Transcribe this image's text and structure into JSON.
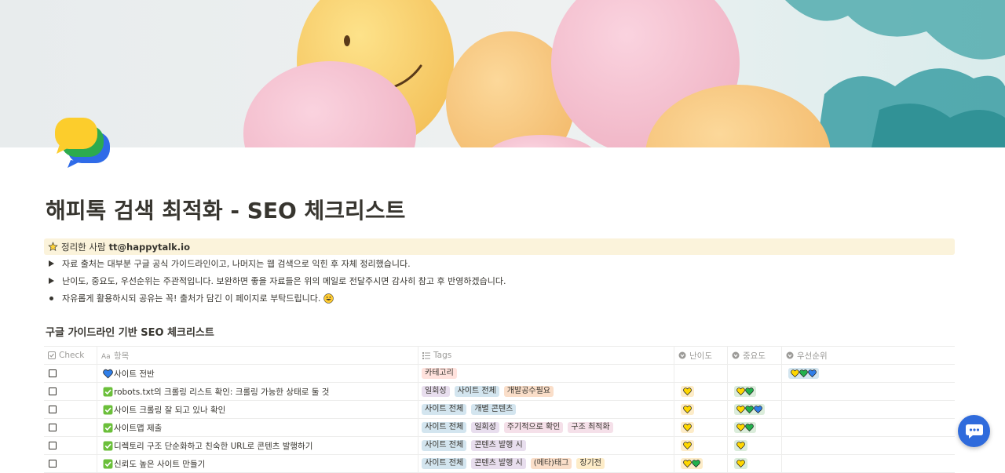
{
  "page": {
    "title": "해피톡 검색 최적화 - SEO 체크리스트",
    "cover_image": "balloons-sky",
    "icon": "chat-bubbles-icon"
  },
  "callout": {
    "icon": "star-icon",
    "label": "정리한 사람",
    "author": "tt@happytalk.io"
  },
  "toggles": [
    "자료 출처는 대부분 구글 공식 가이드라인이고, 나머지는 웹 검색으로 익힌 후 자체 정리했습니다.",
    "난이도, 중요도, 우선순위는 주관적입니다. 보완하면 좋을 자료들은 위의 메일로 전달주시면 감사히 참고 후 반영하겠습니다."
  ],
  "bullet": {
    "text": "자유롭게 활용하시되 공유는 꼭! 출처가 담긴 이 페이지로 부탁드립니다.",
    "emoji": "grinning-face-icon"
  },
  "database": {
    "title": "구글 가이드라인 기반 SEO 체크리스트",
    "columns": [
      "Check",
      "항목",
      "Tags",
      "난이도",
      "중요도",
      "우선순위"
    ],
    "rows": [
      {
        "checked": false,
        "icon": "blue-heart-icon",
        "name": "사이트 전반",
        "tags": [
          {
            "label": "카테고리",
            "color": "red"
          }
        ],
        "difficulty": [],
        "importance": [],
        "priority": [
          "yellow",
          "green",
          "blue"
        ]
      },
      {
        "checked": false,
        "icon": "check-mark-icon",
        "name": "robots.txt의 크롤링 리스트 확인: 크롤링 가능한 상태로 둘 것",
        "tags": [
          {
            "label": "일회성",
            "color": "purple"
          },
          {
            "label": "사이트 전체",
            "color": "blue"
          },
          {
            "label": "개발공수필요",
            "color": "orange"
          }
        ],
        "difficulty": [
          "yellow"
        ],
        "importance": [
          "yellow",
          "green"
        ],
        "priority": []
      },
      {
        "checked": false,
        "icon": "check-mark-icon",
        "name": "사이트 크롤링 잘 되고 있나 확인",
        "tags": [
          {
            "label": "사이트 전체",
            "color": "blue"
          },
          {
            "label": "개별 콘텐츠",
            "color": "blue"
          }
        ],
        "difficulty": [
          "yellow"
        ],
        "importance": [
          "yellow",
          "green",
          "blue"
        ],
        "priority": []
      },
      {
        "checked": false,
        "icon": "check-mark-icon",
        "name": "사이트맵 제출",
        "tags": [
          {
            "label": "사이트 전체",
            "color": "blue"
          },
          {
            "label": "일회성",
            "color": "purple"
          },
          {
            "label": "주기적으로 확인",
            "color": "pink"
          },
          {
            "label": "구조 최적화",
            "color": "pink"
          }
        ],
        "difficulty": [
          "yellow"
        ],
        "importance": [
          "yellow",
          "green"
        ],
        "priority": []
      },
      {
        "checked": false,
        "icon": "check-mark-icon",
        "name": "디렉토리 구조 단순화하고 친숙한 URL로 콘텐츠 발행하기",
        "tags": [
          {
            "label": "사이트 전체",
            "color": "blue"
          },
          {
            "label": "콘텐츠 발행 시",
            "color": "purple"
          }
        ],
        "difficulty": [
          "yellow"
        ],
        "importance": [
          "yellow"
        ],
        "priority": []
      },
      {
        "checked": false,
        "icon": "check-mark-icon",
        "name": "신뢰도 높은 사이트 만들기",
        "tags": [
          {
            "label": "사이트 전체",
            "color": "blue"
          },
          {
            "label": "콘텐츠 발행 시",
            "color": "purple"
          },
          {
            "label": "(메타)태그",
            "color": "orange"
          },
          {
            "label": "장기전",
            "color": "yellow"
          }
        ],
        "difficulty": [
          "yellow",
          "green"
        ],
        "importance": [
          "yellow"
        ],
        "priority": []
      }
    ]
  },
  "colors": {
    "heart_yellow": "#ffd700",
    "heart_green": "#22b14c",
    "heart_blue": "#2f7ee8",
    "check_green": "#6bbf3a",
    "chat_button": "#2f6bdc"
  },
  "chat_button_icon": "chat-dots-icon"
}
